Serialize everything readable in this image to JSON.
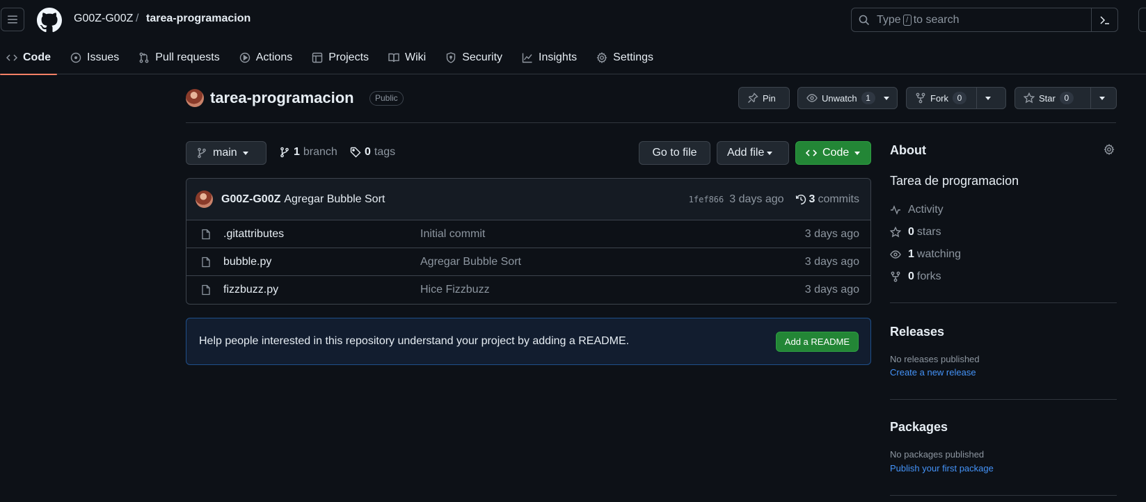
{
  "header": {
    "owner": "G00Z-G00Z",
    "separator": "/",
    "repo": "tarea-programacion",
    "search": {
      "before": "Type",
      "key": "/",
      "after": "to search"
    }
  },
  "tabs": [
    {
      "label": "Code",
      "icon": "code-icon",
      "active": true
    },
    {
      "label": "Issues",
      "icon": "issue-icon"
    },
    {
      "label": "Pull requests",
      "icon": "pull-request-icon"
    },
    {
      "label": "Actions",
      "icon": "play-icon"
    },
    {
      "label": "Projects",
      "icon": "table-icon"
    },
    {
      "label": "Wiki",
      "icon": "book-icon"
    },
    {
      "label": "Security",
      "icon": "shield-icon"
    },
    {
      "label": "Insights",
      "icon": "graph-icon"
    },
    {
      "label": "Settings",
      "icon": "gear-icon"
    }
  ],
  "repo_header": {
    "title": "tarea-programacion",
    "visibility": "Public",
    "pin_label": "Pin",
    "unwatch_label": "Unwatch",
    "watch_count": "1",
    "fork_label": "Fork",
    "fork_count": "0",
    "star_label": "Star",
    "star_count": "0"
  },
  "file_nav": {
    "branch": "main",
    "branch_count": "1",
    "branch_label": "branch",
    "tag_count": "0",
    "tag_label": "tags",
    "go_to_file": "Go to file",
    "add_file": "Add file",
    "code": "Code"
  },
  "latest_commit": {
    "author": "G00Z-G00Z",
    "message": "Agregar Bubble Sort",
    "sha": "1fef866",
    "age": "3 days ago",
    "count": "3",
    "count_label": "commits"
  },
  "files": [
    {
      "name": ".gitattributes",
      "message": "Initial commit",
      "age": "3 days ago"
    },
    {
      "name": "bubble.py",
      "message": "Agregar Bubble Sort",
      "age": "3 days ago"
    },
    {
      "name": "fizzbuzz.py",
      "message": "Hice Fizzbuzz",
      "age": "3 days ago"
    }
  ],
  "readme_banner": {
    "text": "Help people interested in this repository understand your project by adding a README.",
    "button": "Add a README"
  },
  "about": {
    "heading": "About",
    "description": "Tarea de programacion",
    "activity": "Activity",
    "stars_count": "0",
    "stars_label": "stars",
    "watching_count": "1",
    "watching_label": "watching",
    "forks_count": "0",
    "forks_label": "forks"
  },
  "releases": {
    "heading": "Releases",
    "empty": "No releases published",
    "link": "Create a new release"
  },
  "packages": {
    "heading": "Packages",
    "empty": "No packages published",
    "link": "Publish your first package"
  },
  "colors": {
    "background": "#0d1117",
    "accent_green": "#238636",
    "link_blue": "#4493f8",
    "tab_underline": "#f78166"
  }
}
